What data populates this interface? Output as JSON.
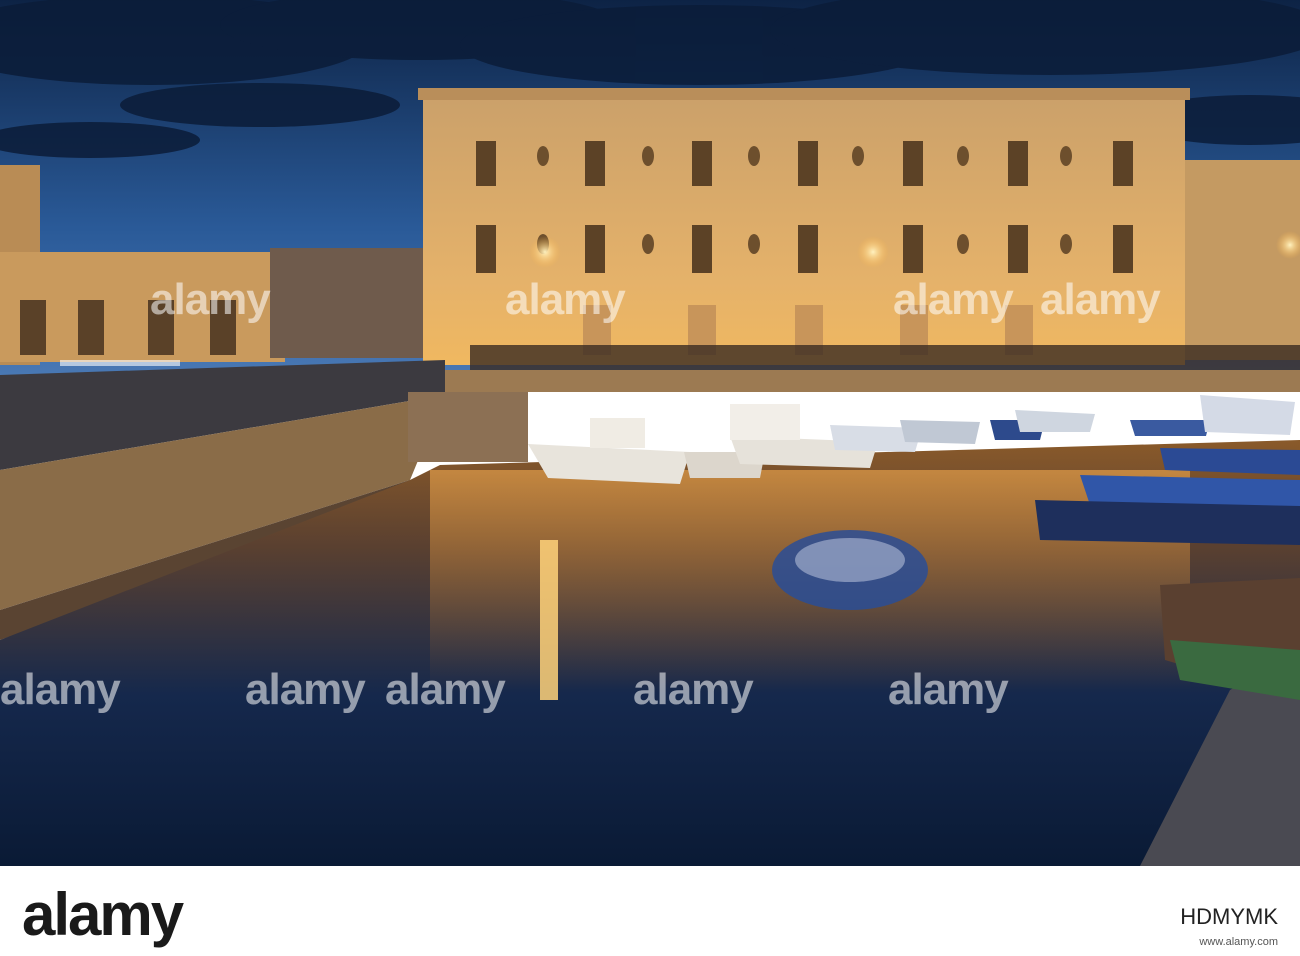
{
  "watermarks": [
    "alamy",
    "alamy",
    "alamy",
    "alamy",
    "alamy",
    "alamy",
    "alamy",
    "alamy",
    "alamy"
  ],
  "footer": {
    "brand": "alamy",
    "image_id": "HDMYMK",
    "url": "www.alamy.com"
  },
  "colors": {
    "sky_top": "#0f2547",
    "sky_bottom": "#2f5c97",
    "building": "#d9a65c",
    "water_dark": "#0c1d3a",
    "lamp_glow": "#ffb94d"
  }
}
